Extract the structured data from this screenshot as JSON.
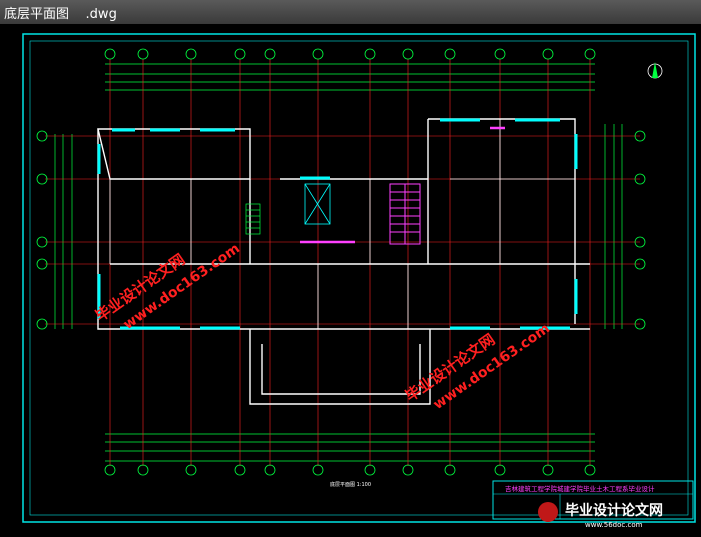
{
  "window": {
    "title": "底层平面图",
    "extension": ".dwg"
  },
  "watermark": {
    "text_cn": "毕业设计论文网",
    "text_url": "www.doc163.com"
  },
  "drawing": {
    "axis_labels_bottom": [
      "①",
      "②",
      "③",
      "④",
      "⑤",
      "⑥",
      "⑦",
      "⑧",
      "⑨",
      "⑩",
      "⑪",
      "⑫"
    ],
    "axis_labels_left": [
      "Ⓐ",
      "Ⓑ",
      "Ⓒ",
      "Ⓓ",
      "Ⓔ"
    ],
    "caption": "底层平面图 1:100",
    "colors": {
      "frame": "#00e5e5",
      "walls": "#ffffff",
      "grid": "#ff2020",
      "dims": "#00ff40",
      "stairs": "#ff40ff",
      "windows": "#00ffff",
      "accent": "#ff3030"
    }
  },
  "title_block": {
    "project": "吉林建筑工程学院城建学院毕业土木工程系毕业设计"
  },
  "corner_logo": {
    "text_cn": "毕业设计论文网",
    "url": "www.56doc.com"
  }
}
